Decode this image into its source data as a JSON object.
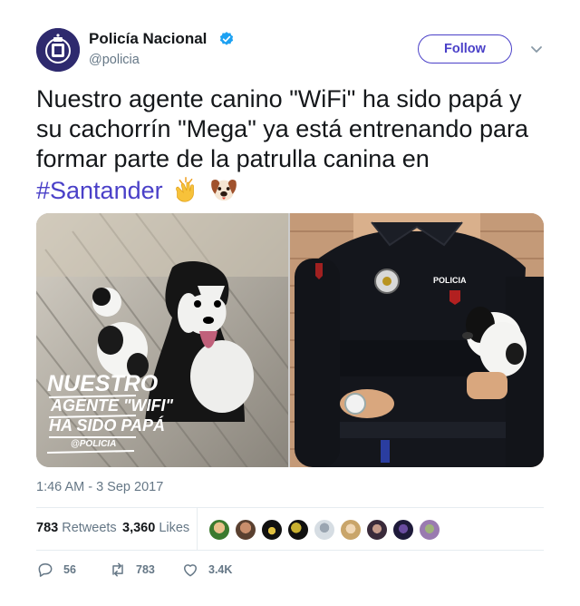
{
  "author": {
    "name": "Policía Nacional",
    "handle": "@policia",
    "verified_icon": "verified-badge-icon",
    "avatar_icon": "police-emblem-icon"
  },
  "follow_button": {
    "label": "Follow"
  },
  "menu_icon": "chevron-down-icon",
  "tweet": {
    "text": "Nuestro agente canino \"WiFi\" ha sido papá y su cachorrín \"Mega\" ya está entrenando para formar parte de la patrulla canina en",
    "hashtag": "#Santander",
    "emojis": [
      "clapping-hands-emoji",
      "dog-face-emoji"
    ]
  },
  "media": {
    "left_photo": {
      "overlay_lines": [
        "NUESTRO",
        "AGENTE \"WIFI\"",
        "HA SIDO PAPÁ",
        "@POLICIA"
      ]
    },
    "right_photo": {
      "vest_label": "POLICIA"
    }
  },
  "timestamp": "1:46 AM - 3 Sep 2017",
  "stats": {
    "retweets_count": "783",
    "retweets_label": "Retweets",
    "likes_count": "3,360",
    "likes_label": "Likes",
    "liker_avatar_count": 9
  },
  "actions": {
    "reply_count": "56",
    "retweet_count": "783",
    "like_count": "3.4K"
  },
  "colors": {
    "accent": "#4a40c8",
    "verified": "#1da1f2",
    "muted_text": "#657786",
    "divider": "#e6ecf0"
  }
}
